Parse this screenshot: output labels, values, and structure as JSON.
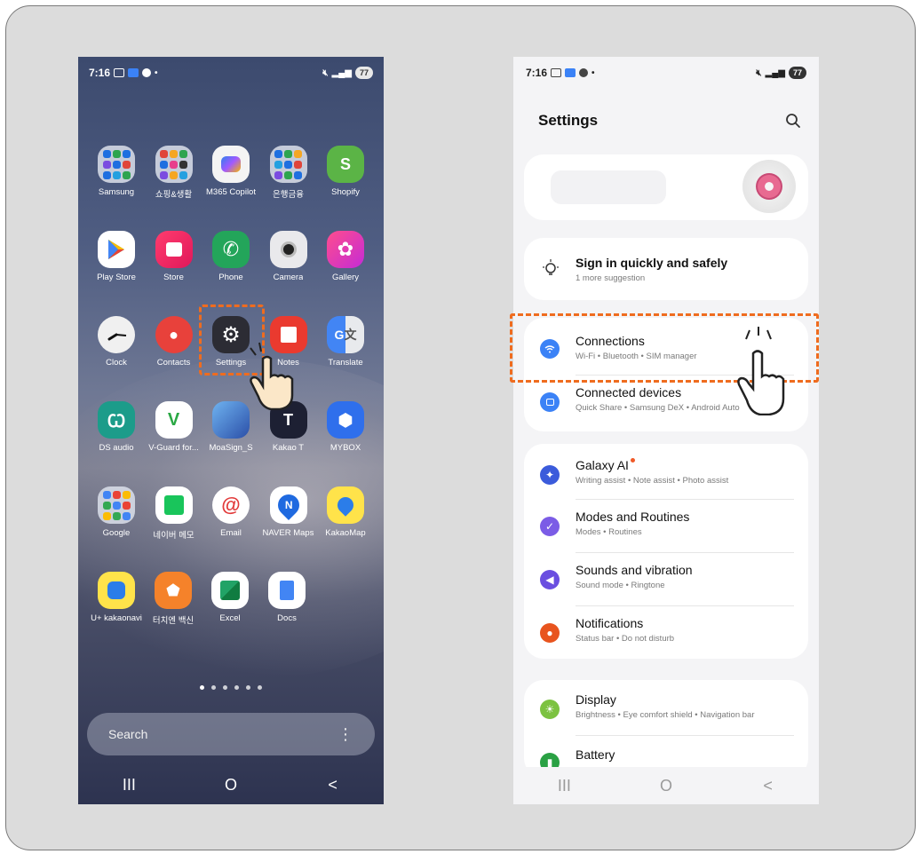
{
  "colors": {
    "highlight": "#ef6c1f",
    "frame_bg": "#dcdcdc",
    "settings_bg": "#f4f4f6",
    "accent_blue": "#3b82f6"
  },
  "home": {
    "status": {
      "time": "7:16",
      "battery": "77"
    },
    "rows": [
      [
        {
          "label": "Samsung",
          "icon": "folder-icon"
        },
        {
          "label": "쇼핑&생활",
          "icon": "folder-icon"
        },
        {
          "label": "M365 Copilot",
          "icon": "copilot-icon"
        },
        {
          "label": "은행금융",
          "icon": "folder-icon"
        },
        {
          "label": "Shopify",
          "icon": "shopify-icon"
        }
      ],
      [
        {
          "label": "Play Store",
          "icon": "play-store-icon"
        },
        {
          "label": "Store",
          "icon": "store-icon"
        },
        {
          "label": "Phone",
          "icon": "phone-icon"
        },
        {
          "label": "Camera",
          "icon": "camera-icon"
        },
        {
          "label": "Gallery",
          "icon": "gallery-icon"
        }
      ],
      [
        {
          "label": "Clock",
          "icon": "clock-icon"
        },
        {
          "label": "Contacts",
          "icon": "contacts-icon"
        },
        {
          "label": "Settings",
          "icon": "gear-icon"
        },
        {
          "label": "Notes",
          "icon": "notes-icon"
        },
        {
          "label": "Translate",
          "icon": "translate-icon"
        }
      ],
      [
        {
          "label": "DS audio",
          "icon": "headphones-icon"
        },
        {
          "label": "V-Guard for...",
          "icon": "vguard-icon"
        },
        {
          "label": "MoaSign_S",
          "icon": "moasign-icon"
        },
        {
          "label": "Kakao T",
          "icon": "kakao-t-icon"
        },
        {
          "label": "MYBOX",
          "icon": "mybox-icon"
        }
      ],
      [
        {
          "label": "Google",
          "icon": "folder-icon"
        },
        {
          "label": "네이버 메모",
          "icon": "naver-memo-icon"
        },
        {
          "label": "Email",
          "icon": "email-icon"
        },
        {
          "label": "NAVER Maps",
          "icon": "naver-maps-icon"
        },
        {
          "label": "KakaoMap",
          "icon": "kakaomap-icon"
        }
      ],
      [
        {
          "label": "U+ kakaonavi",
          "icon": "kakaonavi-icon"
        },
        {
          "label": "터치엔 백신",
          "icon": "vaccine-icon"
        },
        {
          "label": "Excel",
          "icon": "excel-icon"
        },
        {
          "label": "Docs",
          "icon": "docs-icon"
        }
      ]
    ],
    "search_placeholder": "Search",
    "nav": {
      "recents": "III",
      "home": "O",
      "back": "<"
    }
  },
  "settings": {
    "status": {
      "time": "7:16",
      "battery": "77"
    },
    "title": "Settings",
    "suggestion": {
      "title": "Sign in quickly and safely",
      "sub": "1 more suggestion"
    },
    "connections": {
      "title": "Connections",
      "sub": "Wi-Fi  •  Bluetooth  •  SIM manager"
    },
    "connected_devices": {
      "title": "Connected devices",
      "sub": "Quick Share  •  Samsung DeX  •  Android Auto"
    },
    "galaxy_ai": {
      "title": "Galaxy AI",
      "sub": "Writing assist  •  Note assist  •  Photo assist"
    },
    "modes": {
      "title": "Modes and Routines",
      "sub": "Modes  •  Routines"
    },
    "sounds": {
      "title": "Sounds and vibration",
      "sub": "Sound mode  •  Ringtone"
    },
    "notifications": {
      "title": "Notifications",
      "sub": "Status bar  •  Do not disturb"
    },
    "display": {
      "title": "Display",
      "sub": "Brightness  •  Eye comfort shield  •  Navigation bar"
    },
    "battery": {
      "title": "Battery"
    },
    "nav": {
      "recents": "III",
      "home": "O",
      "back": "<"
    }
  }
}
